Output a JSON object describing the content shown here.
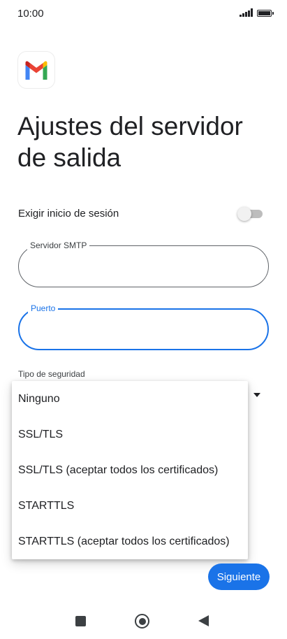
{
  "status_bar": {
    "time": "10:00",
    "icons": [
      "signal-icon",
      "battery-icon"
    ]
  },
  "app": {
    "logo_icon": "gmail-icon",
    "colors": {
      "red": "#EA4335",
      "blue": "#4285F4",
      "green": "#34A853",
      "yellow": "#FBBC04"
    }
  },
  "page": {
    "title": "Ajustes del servidor de salida"
  },
  "login_toggle": {
    "label": "Exigir inicio de sesión",
    "enabled": false
  },
  "smtp_field": {
    "label": "Servidor SMTP",
    "value": ""
  },
  "port_field": {
    "label": "Puerto",
    "value": "",
    "focused": true
  },
  "security": {
    "label": "Tipo de seguridad",
    "options": [
      "Ninguno",
      "SSL/TLS",
      "SSL/TLS (aceptar todos los certificados)",
      "STARTTLS",
      "STARTTLS (aceptar todos los certificados)"
    ]
  },
  "actions": {
    "next_label": "Siguiente"
  },
  "nav": {
    "icons": [
      "recent-apps-icon",
      "home-icon",
      "back-icon"
    ]
  },
  "theme": {
    "accent": "#1a73e8"
  }
}
